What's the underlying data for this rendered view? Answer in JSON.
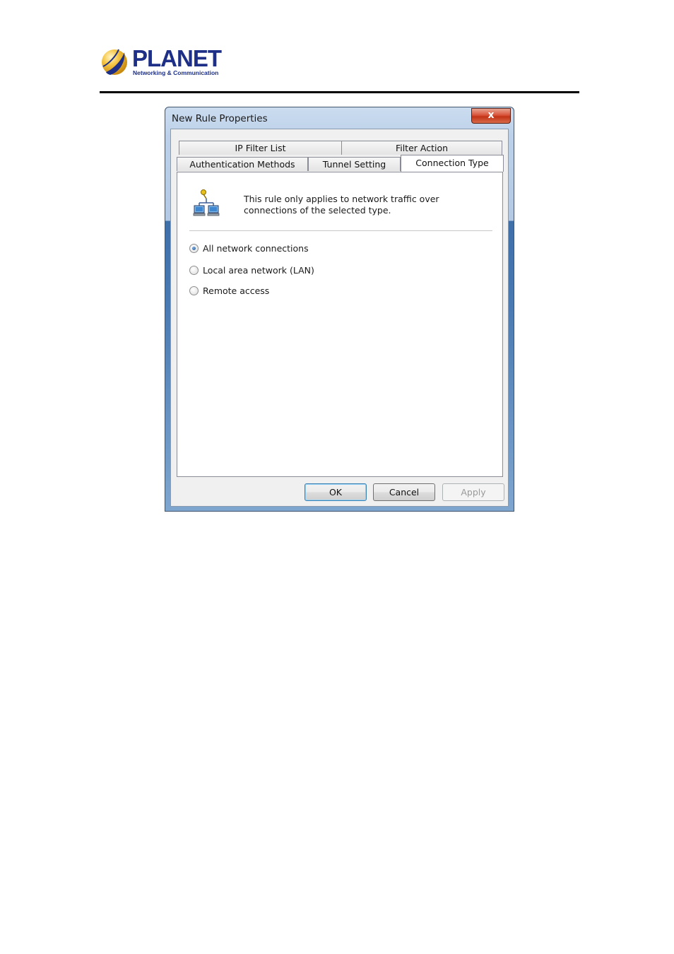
{
  "logo": {
    "name": "PLANET",
    "tagline": "Networking & Communication",
    "colors": {
      "brand": "#1d2f86",
      "globe_light": "#f5c542",
      "globe_dark": "#1d2f86"
    }
  },
  "dialog": {
    "title": "New Rule Properties",
    "close_label": "x",
    "tabs_row1": [
      {
        "label": "IP Filter List"
      },
      {
        "label": "Filter Action"
      }
    ],
    "tabs_row2": [
      {
        "label": "Authentication Methods"
      },
      {
        "label": "Tunnel Setting"
      },
      {
        "label": "Connection Type",
        "active": true
      }
    ],
    "icon": "network-connections-icon",
    "description": "This rule only applies to network traffic over connections of the selected type.",
    "options": [
      {
        "label": "All network connections",
        "checked": true
      },
      {
        "label": "Local area network (LAN)",
        "checked": false
      },
      {
        "label": "Remote access",
        "checked": false
      }
    ],
    "buttons": {
      "ok": "OK",
      "cancel": "Cancel",
      "apply": "Apply"
    }
  }
}
